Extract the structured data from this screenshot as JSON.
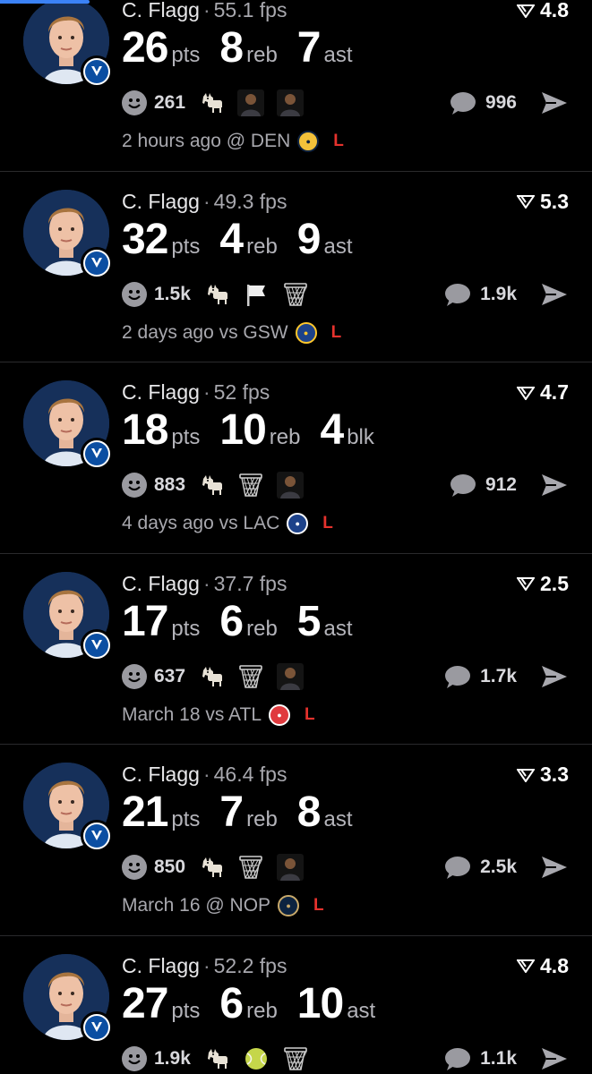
{
  "colors": {
    "background": "#000000",
    "loss": "#e5322d",
    "accent": "#3b82f6"
  },
  "player_name": "C. Flagg",
  "player_team_icon": "dallas-mavericks-logo",
  "posts": [
    {
      "player": "C. Flagg",
      "fps": "55.1 fps",
      "rating": "4.8",
      "stats": [
        {
          "value": "26",
          "unit": "pts"
        },
        {
          "value": "8",
          "unit": "reb"
        },
        {
          "value": "7",
          "unit": "ast"
        }
      ],
      "reaction_count": "261",
      "reactions": [
        "goat-icon",
        "player-photo-icon",
        "player-photo-icon"
      ],
      "comment_count": "996",
      "when": "2 hours ago @ DEN",
      "opponent_icon": "denver-nuggets-logo",
      "opp_color": "#f3c13a",
      "opp_fg": "#0e2240",
      "result": "L"
    },
    {
      "player": "C. Flagg",
      "fps": "49.3 fps",
      "rating": "5.3",
      "stats": [
        {
          "value": "32",
          "unit": "pts"
        },
        {
          "value": "4",
          "unit": "reb"
        },
        {
          "value": "9",
          "unit": "ast"
        }
      ],
      "reaction_count": "1.5k",
      "reactions": [
        "goat-icon",
        "flag-icon",
        "basketball-net-icon"
      ],
      "comment_count": "1.9k",
      "when": "2 days ago vs GSW",
      "opponent_icon": "golden-state-warriors-logo",
      "opp_color": "#1d428a",
      "opp_fg": "#ffc72c",
      "result": "L"
    },
    {
      "player": "C. Flagg",
      "fps": "52 fps",
      "rating": "4.7",
      "stats": [
        {
          "value": "18",
          "unit": "pts"
        },
        {
          "value": "10",
          "unit": "reb"
        },
        {
          "value": "4",
          "unit": "blk"
        }
      ],
      "reaction_count": "883",
      "reactions": [
        "goat-icon",
        "basketball-net-icon",
        "player-photo-icon"
      ],
      "comment_count": "912",
      "when": "4 days ago vs LAC",
      "opponent_icon": "la-clippers-logo",
      "opp_color": "#1d428a",
      "opp_fg": "#ffffff",
      "result": "L"
    },
    {
      "player": "C. Flagg",
      "fps": "37.7 fps",
      "rating": "2.5",
      "stats": [
        {
          "value": "17",
          "unit": "pts"
        },
        {
          "value": "6",
          "unit": "reb"
        },
        {
          "value": "5",
          "unit": "ast"
        }
      ],
      "reaction_count": "637",
      "reactions": [
        "goat-icon",
        "basketball-net-icon",
        "player-photo-icon"
      ],
      "comment_count": "1.7k",
      "when": "March 18 vs ATL",
      "opponent_icon": "atlanta-hawks-logo",
      "opp_color": "#e03a3e",
      "opp_fg": "#ffffff",
      "result": "L"
    },
    {
      "player": "C. Flagg",
      "fps": "46.4 fps",
      "rating": "3.3",
      "stats": [
        {
          "value": "21",
          "unit": "pts"
        },
        {
          "value": "7",
          "unit": "reb"
        },
        {
          "value": "8",
          "unit": "ast"
        }
      ],
      "reaction_count": "850",
      "reactions": [
        "goat-icon",
        "basketball-net-icon",
        "player-photo-icon"
      ],
      "comment_count": "2.5k",
      "when": "March 16 @ NOP",
      "opponent_icon": "new-orleans-pelicans-logo",
      "opp_color": "#0c2340",
      "opp_fg": "#c8a96a",
      "result": "L"
    },
    {
      "player": "C. Flagg",
      "fps": "52.2 fps",
      "rating": "4.8",
      "stats": [
        {
          "value": "27",
          "unit": "pts"
        },
        {
          "value": "6",
          "unit": "reb"
        },
        {
          "value": "10",
          "unit": "ast"
        }
      ],
      "reaction_count": "1.9k",
      "reactions": [
        "goat-icon",
        "tennis-ball-icon",
        "basketball-net-icon"
      ],
      "comment_count": "1.1k",
      "when": "",
      "opponent_icon": "",
      "opp_color": "",
      "opp_fg": "",
      "result": ""
    }
  ]
}
